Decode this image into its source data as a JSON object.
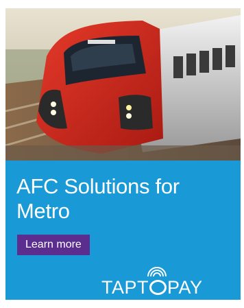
{
  "ad": {
    "image_alt_icon": "train-photo",
    "headline_line1": "AFC Solutions for",
    "headline_line2": "Metro",
    "cta_label": "Learn more",
    "logo": {
      "part1": "TAPT",
      "part2": "PAY"
    },
    "colors": {
      "panel": "#1999d6",
      "cta": "#5b2d8e",
      "text": "#ffffff"
    }
  }
}
